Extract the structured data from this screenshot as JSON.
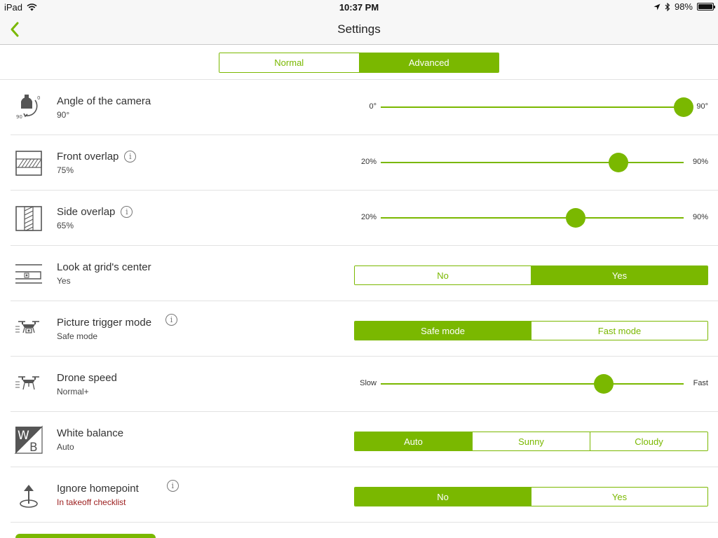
{
  "status_bar": {
    "device": "iPad",
    "time": "10:37 PM",
    "battery": "98%",
    "battery_fraction": 0.98,
    "icons": [
      "wifi-icon",
      "location-arrow-icon",
      "bluetooth-icon",
      "battery-icon"
    ]
  },
  "nav": {
    "title": "Settings",
    "back_icon": "chevron-left-icon"
  },
  "mode_tabs": {
    "options": [
      "Normal",
      "Advanced"
    ],
    "selected": 1
  },
  "colors": {
    "accent": "#7ab800",
    "warning": "#9b1c1c"
  },
  "settings": {
    "camera_angle": {
      "label": "Angle of the camera",
      "value": "90°",
      "min_label": "0°",
      "max_label": "90°",
      "position": 1.0,
      "icon": "camera-gimbal-icon"
    },
    "front_overlap": {
      "label": "Front overlap",
      "value": "75%",
      "min_label": "20%",
      "max_label": "90%",
      "position": 0.7857,
      "icon": "front-overlap-icon",
      "info": "i"
    },
    "side_overlap": {
      "label": "Side overlap",
      "value": "65%",
      "min_label": "20%",
      "max_label": "90%",
      "position": 0.6429,
      "icon": "side-overlap-icon",
      "info": "i"
    },
    "grid_center": {
      "label": "Look at grid's center",
      "value": "Yes",
      "options": [
        "No",
        "Yes"
      ],
      "selected": 1,
      "icon": "grid-center-icon"
    },
    "trigger_mode": {
      "label": "Picture trigger mode",
      "value": "Safe mode",
      "options": [
        "Safe mode",
        "Fast mode"
      ],
      "selected": 0,
      "icon": "drone-camera-icon",
      "info": "i"
    },
    "drone_speed": {
      "label": "Drone speed",
      "value": "Normal+",
      "min_label": "Slow",
      "max_label": "Fast",
      "position": 0.735,
      "icon": "drone-speed-icon"
    },
    "white_balance": {
      "label": "White balance",
      "value": "Auto",
      "options": [
        "Auto",
        "Sunny",
        "Cloudy"
      ],
      "selected": 0,
      "icon": "white-balance-icon"
    },
    "homepoint": {
      "label": "Ignore homepoint",
      "value": "In takeoff checklist",
      "options": [
        "No",
        "Yes"
      ],
      "selected": 0,
      "icon": "homepoint-icon",
      "info": "i"
    }
  }
}
